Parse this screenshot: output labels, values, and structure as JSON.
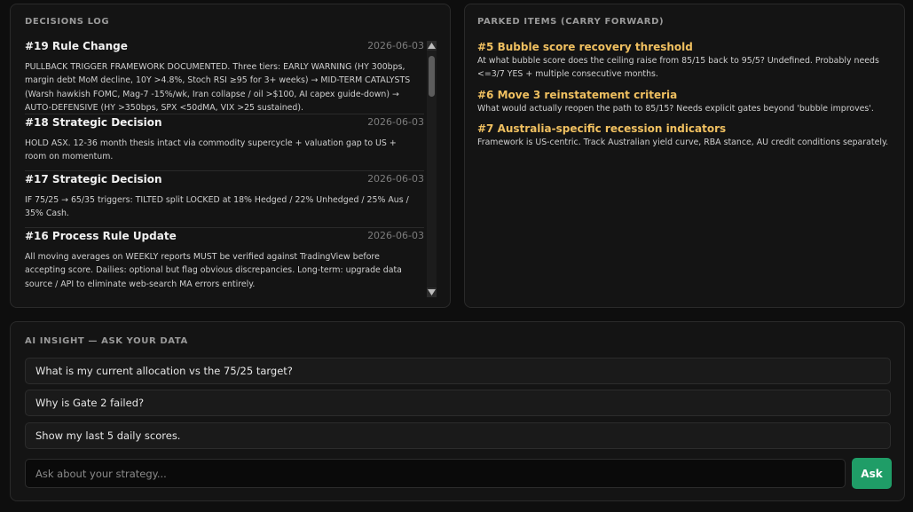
{
  "decisions": {
    "title": "DECISIONS LOG",
    "entries": [
      {
        "title": "#19 Rule Change",
        "date": "2026-06-03",
        "body": "PULLBACK TRIGGER FRAMEWORK DOCUMENTED. Three tiers: EARLY WARNING (HY 300bps, margin debt MoM decline, 10Y >4.8%, Stoch RSI ≥95 for 3+ weeks) → MID-TERM CATALYSTS (Warsh hawkish FOMC, Mag-7 -15%/wk, Iran collapse / oil >$100, AI capex guide-down) → AUTO-DEFENSIVE (HY >350bps, SPX <50dMA, VIX >25 sustained)."
      },
      {
        "title": "#18 Strategic Decision",
        "date": "2026-06-03",
        "body": "HOLD ASX. 12-36 month thesis intact via commodity supercycle + valuation gap to US + room on momentum."
      },
      {
        "title": "#17 Strategic Decision",
        "date": "2026-06-03",
        "body": "IF 75/25 → 65/35 triggers: TILTED split LOCKED at 18% Hedged / 22% Unhedged / 25% Aus / 35% Cash."
      },
      {
        "title": "#16 Process Rule Update",
        "date": "2026-06-03",
        "body": "All moving averages on WEEKLY reports MUST be verified against TradingView before accepting score. Dailies: optional but flag obvious discrepancies. Long-term: upgrade data source / API to eliminate web-search MA errors entirely."
      }
    ]
  },
  "parked": {
    "title": "PARKED ITEMS (CARRY FORWARD)",
    "items": [
      {
        "title": "#5 Bubble score recovery threshold",
        "desc": "At what bubble score does the ceiling raise from 85/15 back to 95/5? Undefined. Probably needs <=3/7 YES + multiple consecutive months."
      },
      {
        "title": "#6 Move 3 reinstatement criteria",
        "desc": "What would actually reopen the path to 85/15? Needs explicit gates beyond 'bubble improves'."
      },
      {
        "title": "#7 Australia-specific recession indicators",
        "desc": "Framework is US-centric. Track Australian yield curve, RBA stance, AU credit conditions separately."
      }
    ]
  },
  "ai": {
    "title": "AI INSIGHT — ASK YOUR DATA",
    "suggestions": [
      "What is my current allocation vs the 75/25 target?",
      "Why is Gate 2 failed?",
      "Show my last 5 daily scores."
    ],
    "input_placeholder": "Ask about your strategy...",
    "input_value": "",
    "ask_label": "Ask"
  },
  "colors": {
    "accent": "#1f9d67",
    "parked_title": "#f0c060",
    "panel_bg": "#141414",
    "page_bg": "#0e0e0e"
  }
}
